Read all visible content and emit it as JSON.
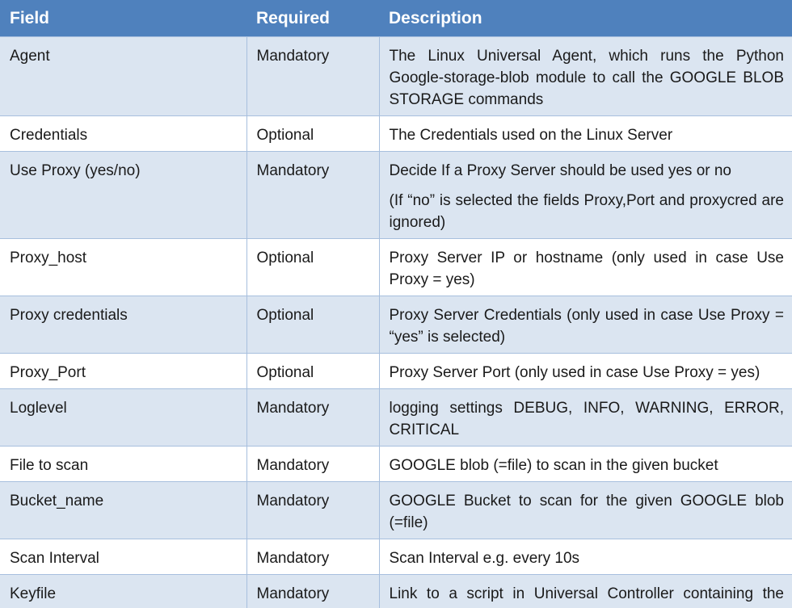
{
  "colors": {
    "header_bg": "#4f81bd",
    "band_bg": "#dbe5f1",
    "border": "#a7bfde"
  },
  "table": {
    "headers": [
      "Field",
      "Required",
      "Description"
    ],
    "rows": [
      {
        "field": "Agent",
        "required": "Mandatory",
        "description": [
          "The Linux Universal Agent, which runs the Python Google-storage-blob module to call the GOOGLE BLOB STORAGE commands"
        ]
      },
      {
        "field": "Credentials",
        "required": "Optional",
        "description": [
          "The Credentials used on the Linux Server"
        ]
      },
      {
        "field": "Use Proxy (yes/no)",
        "required": "Mandatory",
        "description": [
          "Decide If a Proxy Server should be used yes or no",
          "(If “no” is selected the fields Proxy,Port and proxycred are ignored)"
        ]
      },
      {
        "field": "Proxy_host",
        "required": "Optional",
        "description": [
          "Proxy Server IP or hostname (only used in case Use Proxy = yes)"
        ]
      },
      {
        "field": "Proxy credentials",
        "required": "Optional",
        "description": [
          "Proxy Server Credentials (only used in case Use Proxy = “yes” is selected)"
        ]
      },
      {
        "field": "Proxy_Port",
        "required": "Optional",
        "description": [
          "Proxy Server Port (only used in case Use Proxy = yes)"
        ]
      },
      {
        "field": "Loglevel",
        "required": "Mandatory",
        "description": [
          "logging settings DEBUG, INFO, WARNING, ERROR, CRITICAL"
        ]
      },
      {
        "field": "File to scan",
        "required": "Mandatory",
        "description": [
          "GOOGLE blob (=file) to scan in the given bucket"
        ]
      },
      {
        "field": "Bucket_name",
        "required": "Mandatory",
        "description": [
          "GOOGLE Bucket to scan for the given GOOGLE blob (=file)"
        ]
      },
      {
        "field": "Scan Interval",
        "required": "Mandatory",
        "description": [
          "Scan Interval e.g. every 10s"
        ]
      },
      {
        "field": "Keyfile",
        "required": "Mandatory",
        "description": [
          "Link to a script in Universal Controller containing the keyfile"
        ]
      }
    ]
  }
}
